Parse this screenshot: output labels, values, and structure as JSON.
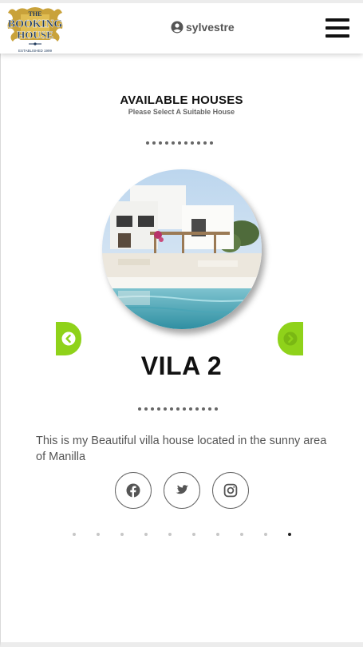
{
  "header": {
    "logo": {
      "line1": "THE",
      "line2": "BOOKING",
      "line3": "HOUSE",
      "tagline": "ESTABLISHED 1999"
    },
    "username": "sylvestre",
    "user_icon": "user-circle-icon",
    "menu_icon": "hamburger-menu-icon"
  },
  "main": {
    "title": "AVAILABLE HOUSES",
    "subtitle": "Please Select A Suitable House",
    "house": {
      "name": "VILA 2",
      "description": "This is my Beautiful villa house located in the sunny area of Manilla"
    },
    "prev_icon": "chevron-left-circle-icon",
    "next_icon": "chevron-right-circle-icon"
  },
  "social": [
    "facebook-icon",
    "twitter-icon",
    "instagram-icon"
  ],
  "pagination": {
    "total": 10,
    "current": 10
  },
  "colors": {
    "accent": "#8fd21a",
    "text": "#111111",
    "muted": "#555555"
  }
}
